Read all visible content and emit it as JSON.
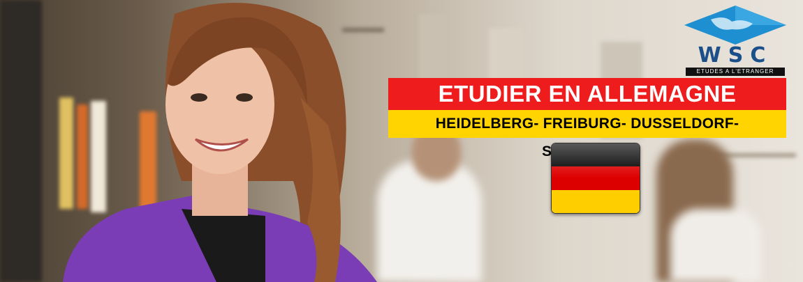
{
  "logo": {
    "text": "WSC",
    "tagline": "ETUDES A L'ETRANGER"
  },
  "headline": "ETUDIER EN ALLEMAGNE",
  "cities": "HEIDELBERG- FREIBURG- DUSSELDORF- STUTTGART",
  "flag": {
    "name": "germany-flag",
    "colors": [
      "#000000",
      "#dd0000",
      "#ffce00"
    ]
  },
  "colors": {
    "headline_bg": "#ee1c1c",
    "subline_bg": "#ffd400",
    "logo_blue": "#1b4f8a"
  }
}
